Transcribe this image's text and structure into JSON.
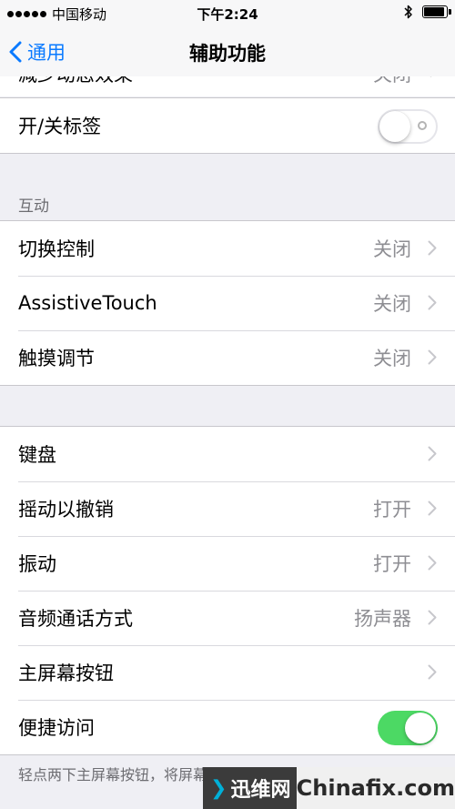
{
  "status_bar": {
    "carrier": "中国移动",
    "time": "下午2:24",
    "bluetooth_icon": "bluetooth-icon",
    "battery_icon": "battery-icon"
  },
  "nav": {
    "back_label": "通用",
    "title": "辅助功能"
  },
  "partial_row": {
    "label": "减少动态效果",
    "value": "关闭"
  },
  "onoff_labels": {
    "label": "开/关标签",
    "state": "off"
  },
  "interaction": {
    "header": "互动",
    "items": [
      {
        "label": "切换控制",
        "value": "关闭"
      },
      {
        "label": "AssistiveTouch",
        "value": "关闭"
      },
      {
        "label": "触摸调节",
        "value": "关闭"
      }
    ]
  },
  "general": {
    "items": [
      {
        "label": "键盘",
        "value": ""
      },
      {
        "label": "摇动以撤销",
        "value": "打开"
      },
      {
        "label": "振动",
        "value": "打开"
      },
      {
        "label": "音频通话方式",
        "value": "扬声器"
      },
      {
        "label": "主屏幕按钮",
        "value": ""
      }
    ],
    "reachability": {
      "label": "便捷访问",
      "state": "on"
    }
  },
  "footer_note": "轻点两下主屏幕按钮，将屏幕上方项目拉至可及范围。",
  "watermark": {
    "left": "迅维网",
    "right": "Chinafix.com"
  },
  "colors": {
    "accent": "#0a7aff",
    "switch_on": "#4cd964",
    "secondary_text": "#8e8e93",
    "background": "#efeff4"
  }
}
